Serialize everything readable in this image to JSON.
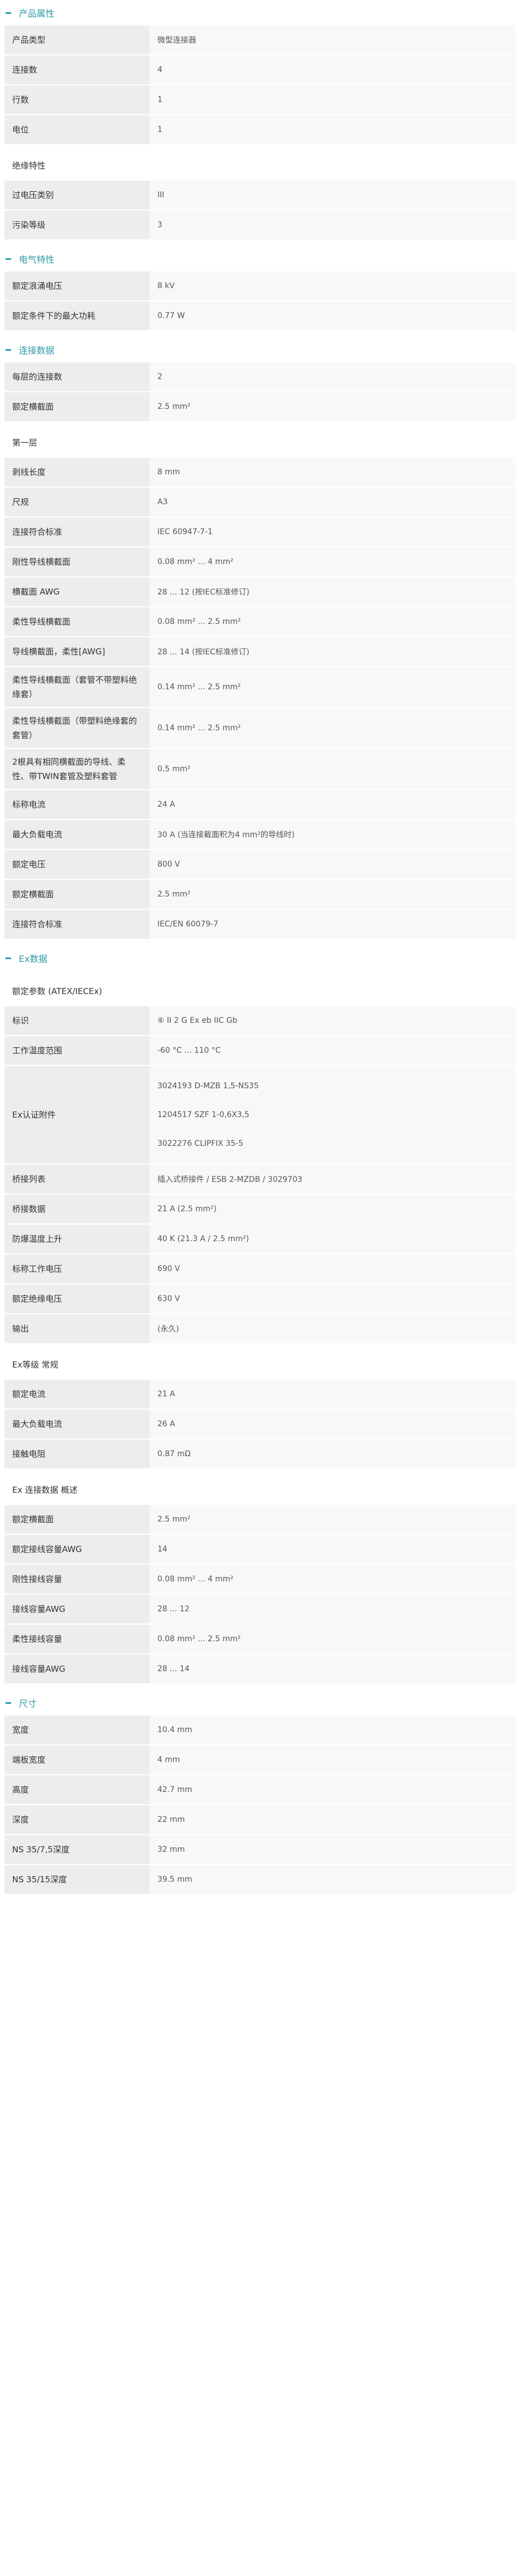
{
  "sections": [
    {
      "title": "产品属性",
      "blocks": [
        {
          "rows": [
            {
              "key": "产品类型",
              "values": [
                "微型连接器"
              ]
            },
            {
              "key": "连接数",
              "values": [
                "4"
              ]
            },
            {
              "key": "行数",
              "values": [
                "1"
              ]
            },
            {
              "key": "电位",
              "values": [
                "1"
              ]
            }
          ]
        },
        {
          "subtitle": "绝缘特性",
          "rows": [
            {
              "key": "过电压类别",
              "values": [
                "III"
              ]
            },
            {
              "key": "污染等级",
              "values": [
                "3"
              ]
            }
          ]
        }
      ]
    },
    {
      "title": "电气特性",
      "blocks": [
        {
          "rows": [
            {
              "key": "额定浪涌电压",
              "values": [
                "8 kV"
              ]
            },
            {
              "key": "额定条件下的最大功耗",
              "values": [
                "0.77 W"
              ]
            }
          ]
        }
      ]
    },
    {
      "title": "连接数据",
      "blocks": [
        {
          "rows": [
            {
              "key": "每层的连接数",
              "values": [
                "2"
              ]
            },
            {
              "key": "额定横截面",
              "values": [
                "2.5 mm²"
              ]
            }
          ]
        },
        {
          "subtitle": "第一层",
          "rows": [
            {
              "key": "剥线长度",
              "values": [
                "8 mm"
              ]
            },
            {
              "key": "尺规",
              "values": [
                "A3"
              ]
            },
            {
              "key": "连接符合标准",
              "values": [
                "IEC 60947-7-1"
              ]
            },
            {
              "key": "刚性导线横截面",
              "values": [
                "0.08 mm² ... 4 mm²"
              ]
            },
            {
              "key": "横截面 AWG",
              "values": [
                "28 ... 12 (按IEC标准修订)"
              ]
            },
            {
              "key": "柔性导线横截面",
              "values": [
                "0.08 mm² ... 2.5 mm²"
              ]
            },
            {
              "key": "导线横截面，柔性[AWG]",
              "values": [
                "28 ... 14 (按IEC标准修订)"
              ]
            },
            {
              "key": "柔性导线横截面（套管不带塑料绝缘套）",
              "values": [
                "0.14 mm² ... 2.5 mm²"
              ],
              "tall": true
            },
            {
              "key": "柔性导线横截面（带塑料绝缘套的套管）",
              "values": [
                "0.14 mm² ... 2.5 mm²"
              ],
              "tall": true
            },
            {
              "key": "2根具有相同横截面的导线、柔性、带TWIN套管及塑料套管",
              "values": [
                "0.5 mm²"
              ],
              "tall": true
            },
            {
              "key": "标称电流",
              "values": [
                "24 A"
              ]
            },
            {
              "key": "最大负载电流",
              "values": [
                "30 A (当连接截面积为4 mm²的导线时)"
              ]
            },
            {
              "key": "额定电压",
              "values": [
                "800 V"
              ]
            },
            {
              "key": "额定横截面",
              "values": [
                "2.5 mm²"
              ]
            },
            {
              "key": "连接符合标准",
              "values": [
                "IEC/EN 60079-7"
              ]
            }
          ]
        }
      ]
    },
    {
      "title": "Ex数据",
      "blocks": [
        {
          "subtitle": "额定参数 (ATEX/IECEx)",
          "rows": [
            {
              "key": "标识",
              "values": [
                "⑥ II 2 G  Ex eb IIC Gb"
              ]
            },
            {
              "key": "工作温度范围",
              "values": [
                "-60 °C ... 110 °C"
              ]
            },
            {
              "key": "Ex认证附件",
              "values": [
                "3024193 D-MZB 1,5-NS35",
                "1204517 SZF 1-0,6X3,5",
                "3022276 CLIPFIX 35-5"
              ]
            },
            {
              "key": "桥接列表",
              "values": [
                "插入式桥接件 / ESB 2-MZDB / 3029703"
              ]
            },
            {
              "key": "桥接数据",
              "values": [
                "21 A (2.5 mm²)"
              ]
            },
            {
              "key": "防爆温度上升",
              "values": [
                "40 K (21.3 A / 2.5 mm²)"
              ]
            },
            {
              "key": "标称工作电压",
              "values": [
                "690 V"
              ]
            },
            {
              "key": "额定绝缘电压",
              "values": [
                "630 V"
              ]
            },
            {
              "key": "输出",
              "values": [
                "(永久)"
              ]
            }
          ]
        },
        {
          "subtitle": "Ex等级 常规",
          "rows": [
            {
              "key": "额定电流",
              "values": [
                "21 A"
              ]
            },
            {
              "key": "最大负载电流",
              "values": [
                "26 A"
              ]
            },
            {
              "key": "接触电阻",
              "values": [
                "0.87 mΩ"
              ]
            }
          ]
        },
        {
          "subtitle": "Ex 连接数据 概述",
          "rows": [
            {
              "key": "额定横截面",
              "values": [
                "2.5 mm²"
              ]
            },
            {
              "key": "额定接线容量AWG",
              "values": [
                "14"
              ]
            },
            {
              "key": "刚性接线容量",
              "values": [
                "0.08 mm² ... 4 mm²"
              ]
            },
            {
              "key": "接线容量AWG",
              "values": [
                "28 ... 12"
              ]
            },
            {
              "key": "柔性接线容量",
              "values": [
                "0.08 mm² ... 2.5 mm²"
              ]
            },
            {
              "key": "接线容量AWG",
              "values": [
                "28 ... 14"
              ]
            }
          ]
        }
      ]
    },
    {
      "title": "尺寸",
      "blocks": [
        {
          "rows": [
            {
              "key": "宽度",
              "values": [
                "10.4 mm"
              ]
            },
            {
              "key": "端板宽度",
              "values": [
                "4 mm"
              ]
            },
            {
              "key": "高度",
              "values": [
                "42.7 mm"
              ]
            },
            {
              "key": "深度",
              "values": [
                "22 mm"
              ]
            },
            {
              "key": "NS 35/7,5深度",
              "values": [
                "32 mm"
              ]
            },
            {
              "key": "NS 35/15深度",
              "values": [
                "39.5 mm"
              ]
            }
          ]
        }
      ]
    }
  ]
}
